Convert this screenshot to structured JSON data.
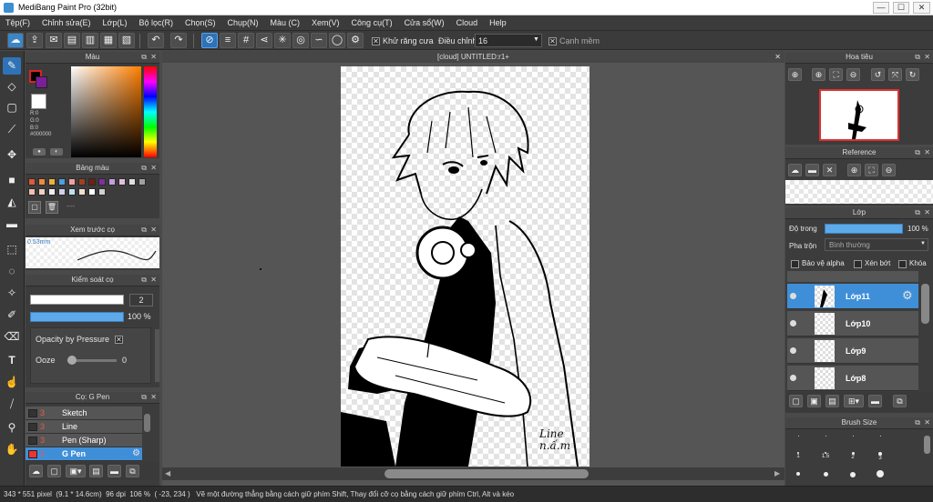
{
  "app": {
    "title": "MediBang Paint Pro (32bit)"
  },
  "window_controls": {
    "minimize": "—",
    "maximize": "☐",
    "close": "✕"
  },
  "menu": [
    "Tệp(F)",
    "Chỉnh sửa(E)",
    "Lớp(L)",
    "Bộ lọc(R)",
    "Chọn(S)",
    "Chụp(N)",
    "Màu (C)",
    "Xem(V)",
    "Công cụ(T)",
    "Cửa sổ(W)",
    "Cloud",
    "Help"
  ],
  "toolbar": {
    "antialias_label": "Khử răng cưa",
    "adjust_label": "Điều chỉnh",
    "adjust_value": "16",
    "smooth_label": "Cạnh mềm",
    "antialias_checked": "✕",
    "smooth_checked": "✕"
  },
  "canvas": {
    "tab_title": "[cloud] UNTITLED:r1+",
    "signature": "Line\nn.ấ.m"
  },
  "color_panel": {
    "title": "Màu",
    "r": "R:0",
    "g": "G:0",
    "b": "B:0",
    "hex": "#000000"
  },
  "palette_panel": {
    "title": "Bảng màu",
    "dots": "----",
    "colors": [
      "#e05a3a",
      "#f08a3a",
      "#f0b03a",
      "#4aa0e0",
      "#f0a0a0",
      "#a04020",
      "#702010",
      "#8030a0",
      "#c0a0e0",
      "#e0c0e0",
      "#e0e0e0",
      "#a0a0a0",
      "#f0c0b0",
      "#f0d0c0",
      "#f0f0f0",
      "#d0d0f0",
      "#c0e0f0",
      "#f0e0d0",
      "#ffffff",
      "#d0d0d0"
    ]
  },
  "preview_panel": {
    "title": "Xem trước cọ",
    "size": "0.53mm"
  },
  "brush_control": {
    "title": "Kiểm soát cọ",
    "size_value": "2",
    "opacity_value": "100 %",
    "opacity_by_pressure": "Opacity by Pressure",
    "opacity_check": "✕",
    "ooze_label": "Ooze",
    "ooze_value": "0"
  },
  "brush_list": {
    "title": "Cọ: G Pen",
    "items": [
      {
        "num": "3",
        "name": "Sketch"
      },
      {
        "num": "3",
        "name": "Line"
      },
      {
        "num": "3",
        "name": "Pen (Sharp)"
      },
      {
        "num": "2",
        "name": "G Pen"
      }
    ]
  },
  "navigator": {
    "title": "Hoa tiêu"
  },
  "reference": {
    "title": "Reference"
  },
  "layers": {
    "title": "Lớp",
    "opacity_label": "Độ trong",
    "opacity_value": "100 %",
    "blend_label": "Pha trộn",
    "blend_value": "Bình thường",
    "protect_alpha": "Bảo vệ alpha",
    "clipping": "Xén bớt",
    "lock": "Khóa",
    "items": [
      {
        "name": "Lớp11"
      },
      {
        "name": "Lớp10"
      },
      {
        "name": "Lớp9"
      },
      {
        "name": "Lớp8"
      }
    ]
  },
  "brush_size": {
    "title": "Brush Size",
    "labels": [
      "1",
      "1.5",
      "2",
      "3"
    ]
  },
  "status": {
    "size": "343 * 551 pixel",
    "dims": "(9.1 * 14.6cm)",
    "dpi": "96 dpi",
    "zoom": "106 %",
    "coords": "( -23, 234 )",
    "hint": "Vẽ một đường thẳng bằng cách giữ phím Shift, Thay đổi cỡ cọ bằng cách giữ phím Ctrl, Alt và kéo"
  }
}
